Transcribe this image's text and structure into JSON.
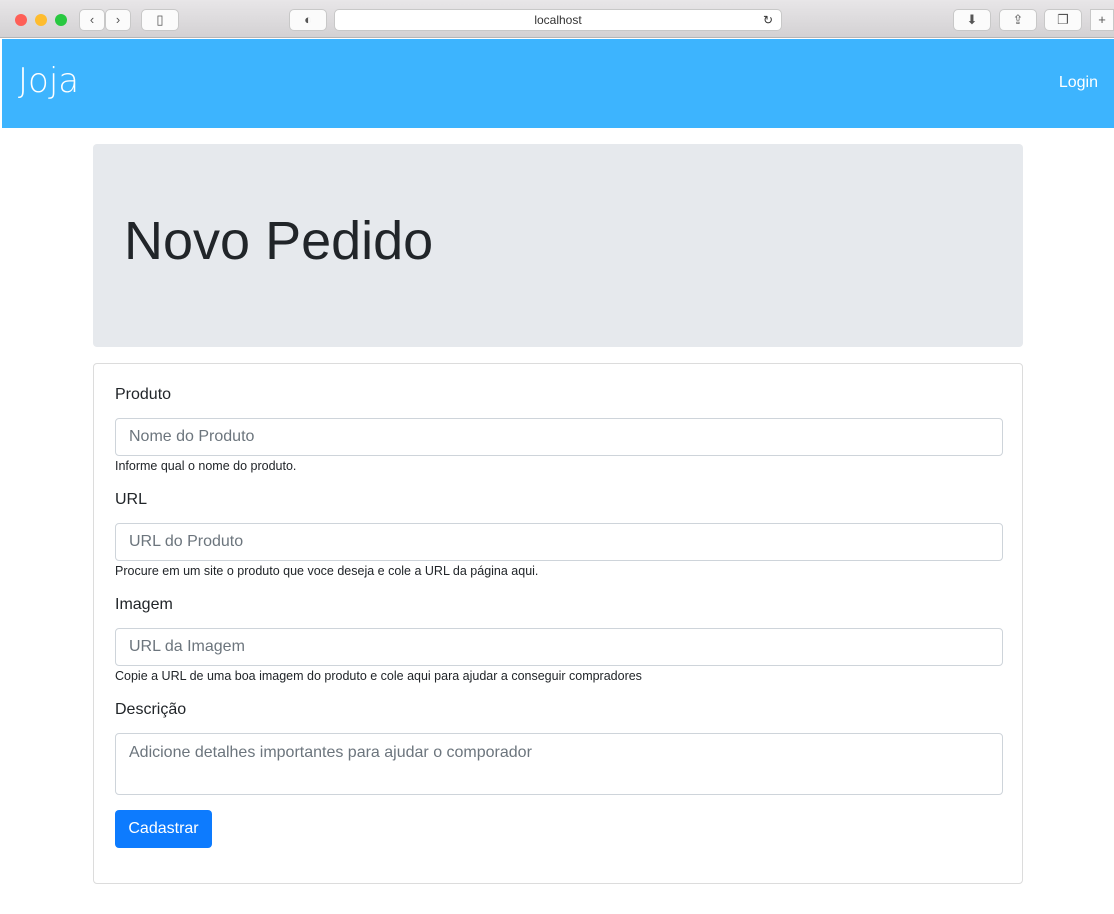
{
  "browser": {
    "url": "localhost"
  },
  "navbar": {
    "brand": "Joja",
    "login": "Login"
  },
  "jumbotron": {
    "title": "Novo Pedido"
  },
  "form": {
    "fields": [
      {
        "label": "Produto",
        "placeholder": "Nome do Produto",
        "help": "Informe qual o nome do produto."
      },
      {
        "label": "URL",
        "placeholder": "URL do Produto",
        "help": "Procure em um site o produto que voce deseja e cole a URL da página aqui."
      },
      {
        "label": "Imagem",
        "placeholder": "URL da Imagem",
        "help": "Copie a URL de uma boa imagem do produto e cole aqui para ajudar a conseguir compradores"
      },
      {
        "label": "Descrição",
        "placeholder": "Adicione detalhes importantes para ajudar o comporador"
      }
    ],
    "submit": "Cadastrar"
  }
}
